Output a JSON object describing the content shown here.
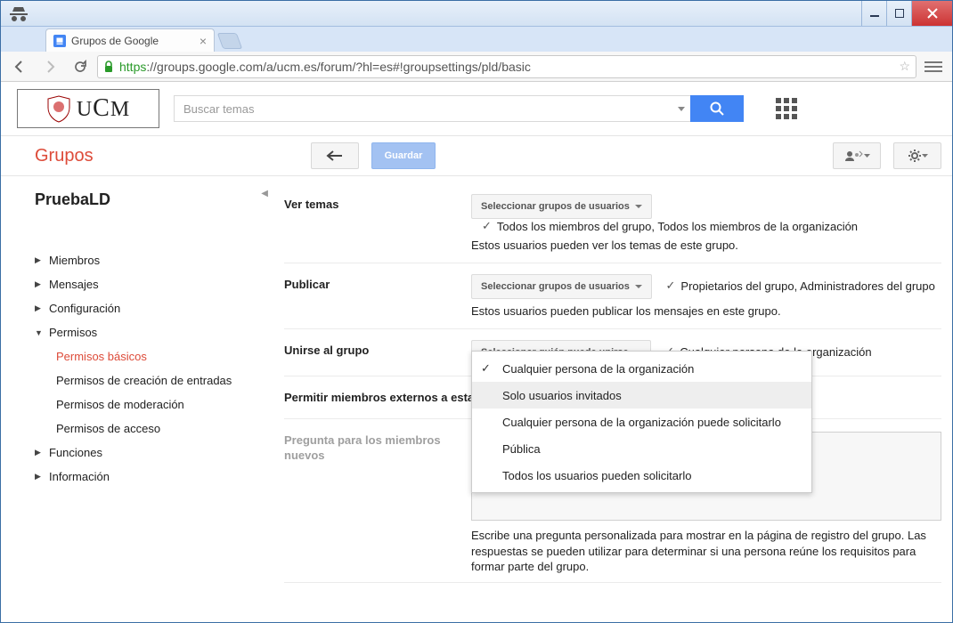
{
  "window": {
    "tab_title": "Grupos de Google",
    "url_https": "https",
    "url_rest": "://groups.google.com/a/ucm.es/forum/?hl=es#!groupsettings/pld/basic"
  },
  "header": {
    "logo_text": "UCM",
    "search_placeholder": "Buscar temas"
  },
  "subbar": {
    "title": "Grupos",
    "save_label": "Guardar"
  },
  "sidebar": {
    "group_name": "PruebaLD",
    "items": [
      {
        "label": "Miembros"
      },
      {
        "label": "Mensajes"
      },
      {
        "label": "Configuración"
      },
      {
        "label": "Permisos",
        "expanded": true,
        "children": [
          {
            "label": "Permisos básicos",
            "active": true
          },
          {
            "label": "Permisos de creación de entradas"
          },
          {
            "label": "Permisos de moderación"
          },
          {
            "label": "Permisos de acceso"
          }
        ]
      },
      {
        "label": "Funciones"
      },
      {
        "label": "Información"
      }
    ]
  },
  "content": {
    "rows": [
      {
        "label": "Ver temas",
        "select_label": "Seleccionar grupos de usuarios",
        "selected_text": "Todos los miembros del grupo, Todos los miembros de la organización",
        "help": "Estos usuarios pueden ver los temas de este grupo."
      },
      {
        "label": "Publicar",
        "select_label": "Seleccionar grupos de usuarios",
        "selected_text": "Propietarios del grupo, Administradores del grupo",
        "help": "Estos usuarios pueden publicar los mensajes en este grupo."
      },
      {
        "label": "Unirse al grupo",
        "select_label": "Seleccionar quién puede unirse",
        "selected_text": "Cualquier persona de la organización"
      }
    ],
    "external_label": "Permitir miembros externos a esta organización",
    "question_label": "Pregunta para los miembros nuevos",
    "question_help": "Escribe una pregunta personalizada para mostrar en la página de registro del grupo. Las respuestas se pueden utilizar para determinar si una persona reúne los requisitos para formar parte del grupo."
  },
  "dropdown": {
    "items": [
      {
        "label": "Cualquier persona de la organización",
        "checked": true
      },
      {
        "label": "Solo usuarios invitados",
        "hover": true
      },
      {
        "label": "Cualquier persona de la organización puede solicitarlo"
      },
      {
        "label": "Pública"
      },
      {
        "label": "Todos los usuarios pueden solicitarlo"
      }
    ]
  }
}
